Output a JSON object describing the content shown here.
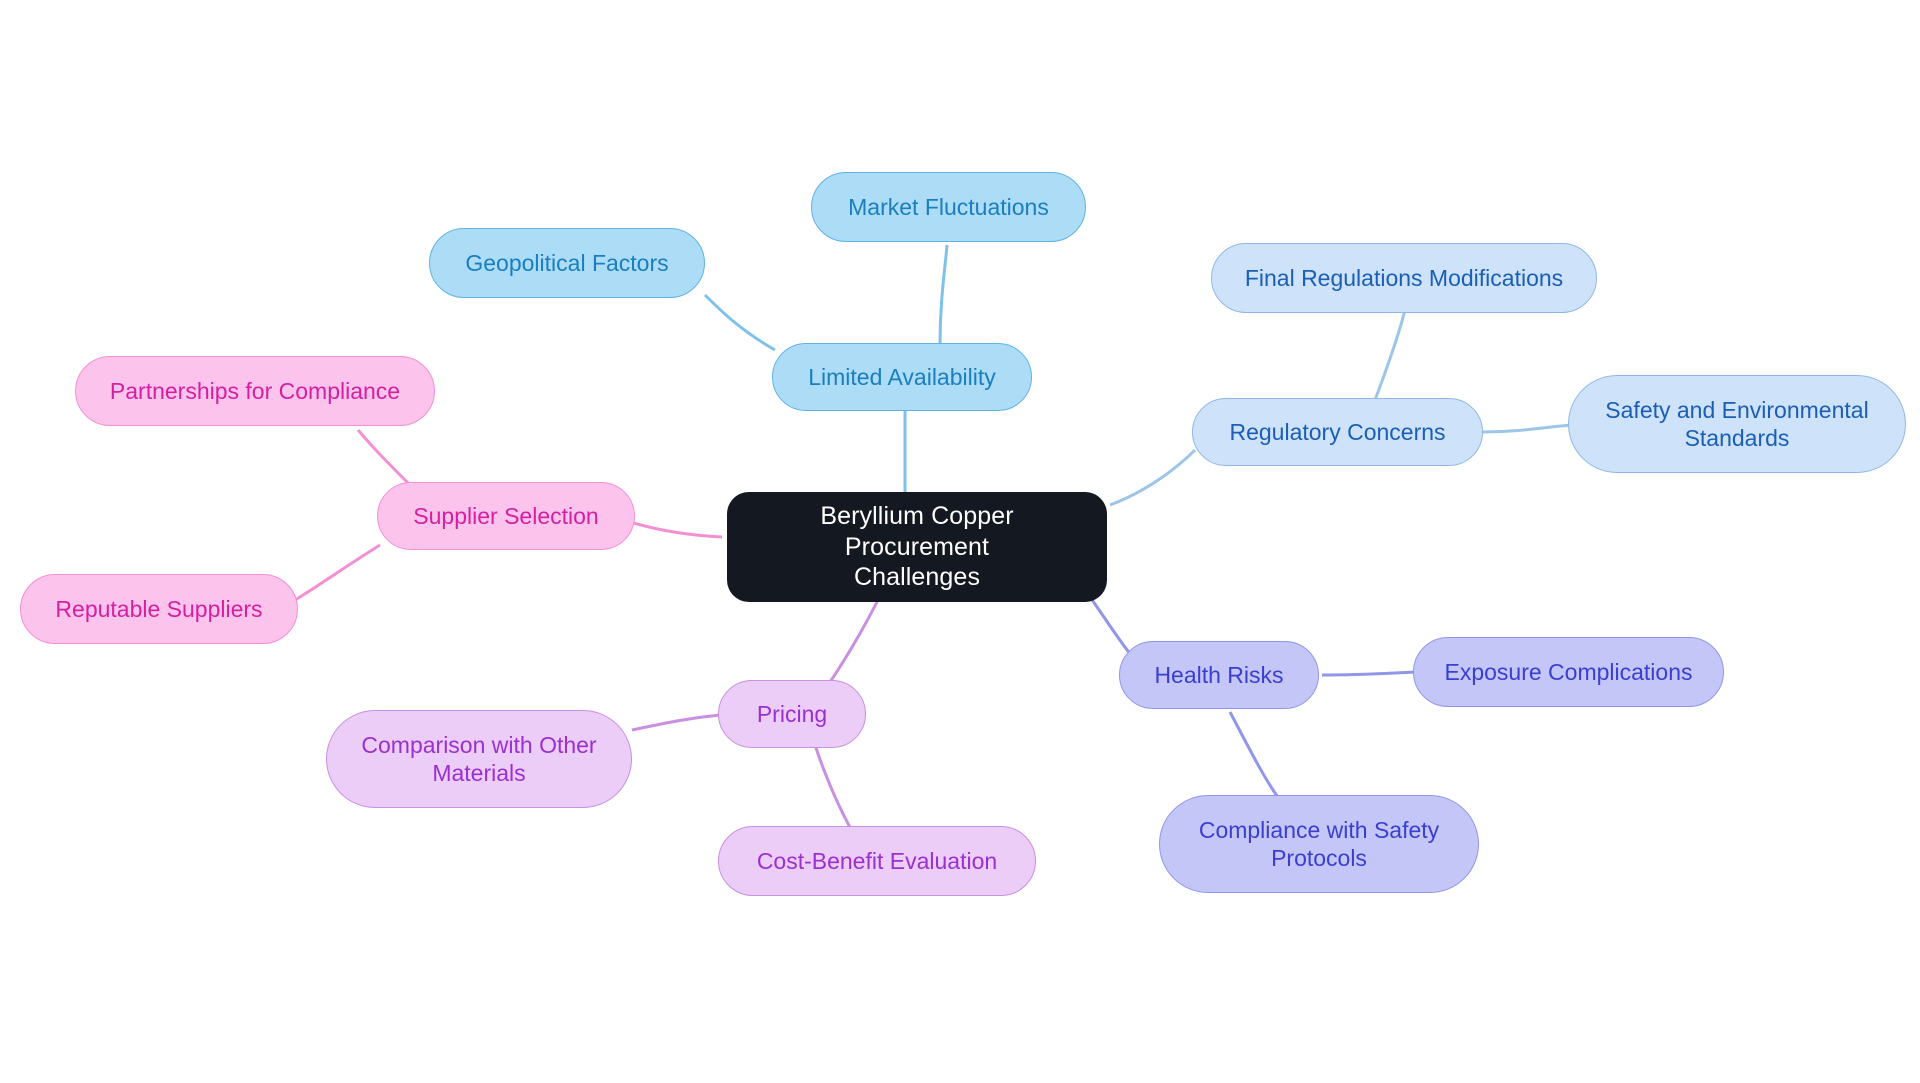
{
  "diagram": {
    "type": "mindmap",
    "title": "Beryllium Copper Procurement Challenges",
    "background": "#ffffff"
  },
  "palette": {
    "root_fill": "#141820",
    "root_text": "#ffffff",
    "availability_fill": "#addcf7",
    "availability_border": "#60b2e5",
    "availability_text": "#1a7fbf",
    "regulatory_fill": "#cee2fa",
    "regulatory_border": "#8fb8e8",
    "regulatory_text": "#1a5fb4",
    "health_fill": "#c3c6f7",
    "health_border": "#9196e8",
    "health_text": "#3b3fcf",
    "pricing_fill": "#eccdf7",
    "pricing_border": "#c98fe0",
    "pricing_text": "#9b30d0",
    "supplier_fill": "#fcc4ec",
    "supplier_border": "#f48fd4",
    "supplier_text": "#d61fa0"
  },
  "nodes": {
    "root": {
      "label": "Beryllium Copper Procurement\nChallenges"
    },
    "limited_availability": {
      "label": "Limited Availability"
    },
    "market_fluctuations": {
      "label": "Market Fluctuations"
    },
    "geopolitical_factors": {
      "label": "Geopolitical Factors"
    },
    "regulatory_concerns": {
      "label": "Regulatory Concerns"
    },
    "final_regulations": {
      "label": "Final Regulations Modifications"
    },
    "safety_standards": {
      "label": "Safety and Environmental\nStandards"
    },
    "health_risks": {
      "label": "Health Risks"
    },
    "exposure_complications": {
      "label": "Exposure Complications"
    },
    "compliance_protocols": {
      "label": "Compliance with Safety\nProtocols"
    },
    "pricing": {
      "label": "Pricing"
    },
    "comparison_materials": {
      "label": "Comparison with Other\nMaterials"
    },
    "cost_benefit": {
      "label": "Cost-Benefit Evaluation"
    },
    "supplier_selection": {
      "label": "Supplier Selection"
    },
    "partnerships_compliance": {
      "label": "Partnerships for Compliance"
    },
    "reputable_suppliers": {
      "label": "Reputable Suppliers"
    }
  },
  "chart_data": {
    "type": "diagram",
    "title": "Beryllium Copper Procurement Challenges",
    "root": "Beryllium Copper Procurement Challenges",
    "branches": [
      {
        "name": "Limited Availability",
        "color": "#addcf7",
        "children": [
          "Market Fluctuations",
          "Geopolitical Factors"
        ]
      },
      {
        "name": "Regulatory Concerns",
        "color": "#cee2fa",
        "children": [
          "Final Regulations Modifications",
          "Safety and Environmental Standards"
        ]
      },
      {
        "name": "Health Risks",
        "color": "#c3c6f7",
        "children": [
          "Exposure Complications",
          "Compliance with Safety Protocols"
        ]
      },
      {
        "name": "Pricing",
        "color": "#eccdf7",
        "children": [
          "Comparison with Other Materials",
          "Cost-Benefit Evaluation"
        ]
      },
      {
        "name": "Supplier Selection",
        "color": "#fcc4ec",
        "children": [
          "Partnerships for Compliance",
          "Reputable Suppliers"
        ]
      }
    ]
  }
}
